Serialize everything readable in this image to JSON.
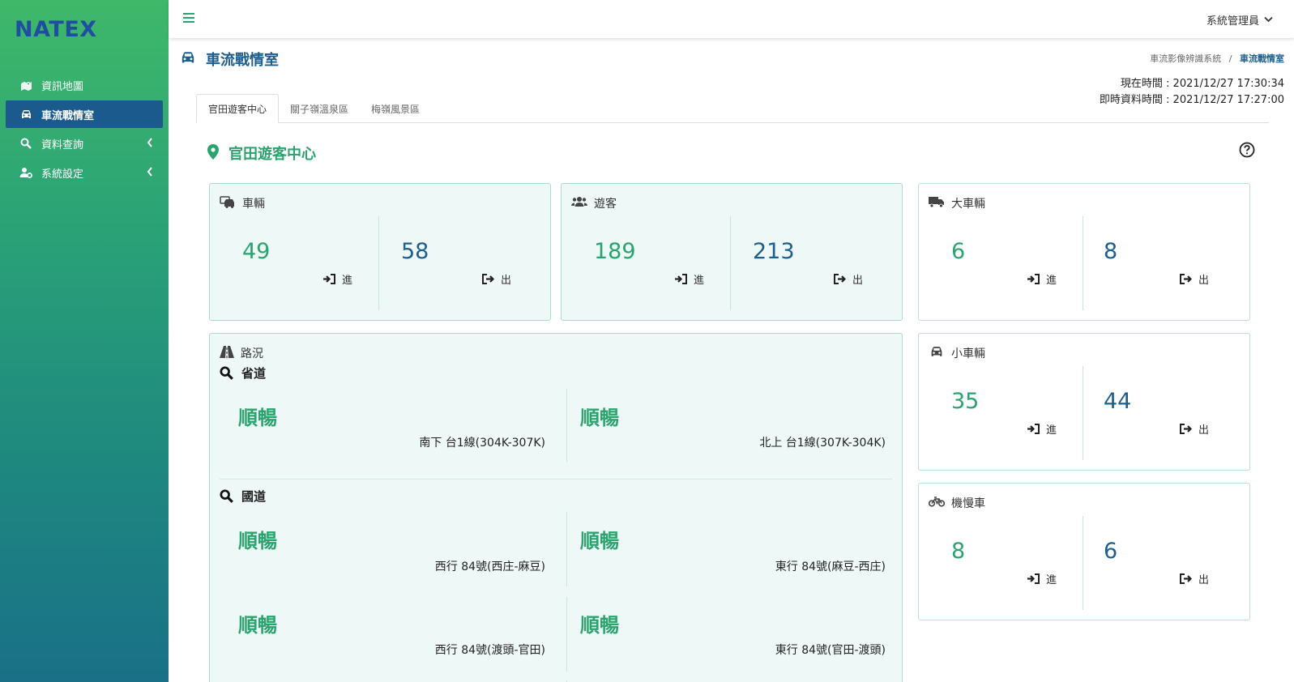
{
  "app": {
    "logo_text": "NATEX",
    "brand_colors": {
      "sidebar_top": "#3fb86a",
      "sidebar_bottom": "#197087",
      "primary_blue": "#1c5e8d",
      "accent_green": "#2aa36e",
      "logo_yellow": "#f2c21b"
    }
  },
  "sidebar": {
    "items": [
      {
        "label": "資訊地圖",
        "icon": "map-icon",
        "active": false,
        "has_chevron": false
      },
      {
        "label": "車流戰情室",
        "icon": "car-icon",
        "active": true,
        "has_chevron": false
      },
      {
        "label": "資料查詢",
        "icon": "search-icon",
        "active": false,
        "has_chevron": true
      },
      {
        "label": "系統設定",
        "icon": "user-cog-icon",
        "active": false,
        "has_chevron": true
      }
    ]
  },
  "topbar": {
    "menu_icon": "hamburger-icon",
    "user_label": "系統管理員"
  },
  "page": {
    "title": "車流戰情室",
    "breadcrumb": {
      "parent": "車流影像辨識系統",
      "separator": "/",
      "current": "車流戰情室"
    },
    "current_time": "現在時間 : 2021/12/27 17:30:34",
    "data_time": "即時資料時間 : 2021/12/27 17:27:00"
  },
  "tabs": [
    {
      "label": "官田遊客中心",
      "active": true
    },
    {
      "label": "關子嶺溫泉區",
      "active": false
    },
    {
      "label": "梅嶺風景區",
      "active": false
    }
  ],
  "section": {
    "title": "官田遊客中心",
    "icon": "map-marker-icon",
    "help_icon": "question-circle-icon"
  },
  "labels": {
    "in": "進",
    "out": "出"
  },
  "stats": {
    "vehicles": {
      "title": "車輛",
      "in": "49",
      "out": "58"
    },
    "visitors": {
      "title": "遊客",
      "in": "189",
      "out": "213"
    },
    "large_vehicles": {
      "title": "大車輛",
      "in": "6",
      "out": "8"
    },
    "small_vehicles": {
      "title": "小車輛",
      "in": "35",
      "out": "44"
    },
    "motorcycles": {
      "title": "機慢車",
      "in": "8",
      "out": "6"
    }
  },
  "road": {
    "title": "路況",
    "provincial": {
      "title": "省道",
      "items": [
        {
          "status": "順暢",
          "label": "南下 台1線(304K-307K)"
        },
        {
          "status": "順暢",
          "label": "北上 台1線(307K-304K)"
        }
      ]
    },
    "national": {
      "title": "國道",
      "items": [
        {
          "status": "順暢",
          "label": "西行 84號(西庄-麻豆)"
        },
        {
          "status": "順暢",
          "label": "東行 84號(麻豆-西庄)"
        },
        {
          "status": "順暢",
          "label": "西行 84號(渡頭-官田)"
        },
        {
          "status": "順暢",
          "label": "東行 84號(官田-渡頭)"
        }
      ]
    }
  }
}
